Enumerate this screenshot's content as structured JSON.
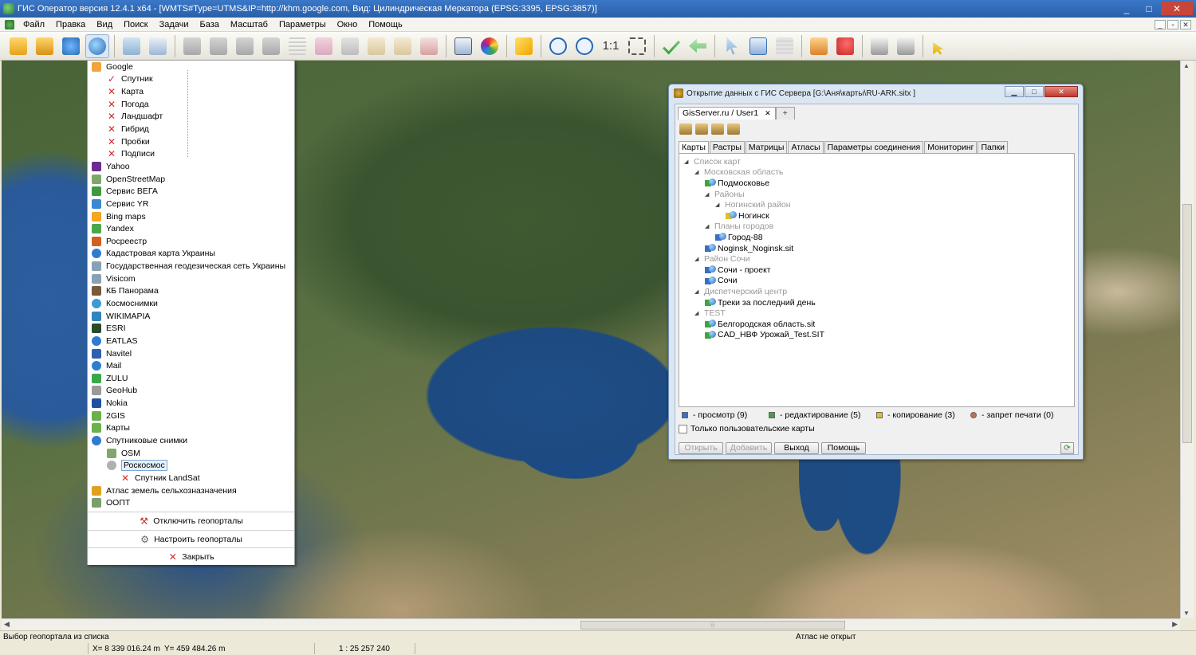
{
  "window": {
    "title": "ГИС Оператор версия 12.4.1 x64 - [WMTS#Type=UTMS&IP=http://khm.google.com, Вид: Цилиндрическая Меркатора (EPSG:3395, EPSG:3857)]",
    "controls": [
      "_",
      "□",
      "✕"
    ]
  },
  "menubar": {
    "items": [
      "Файл",
      "Правка",
      "Вид",
      "Поиск",
      "Задачи",
      "База",
      "Масштаб",
      "Параметры",
      "Окно",
      "Помощь"
    ],
    "mdi_controls": [
      "_",
      "▫",
      "✕"
    ]
  },
  "toolbar": {
    "scale_button": "1:1"
  },
  "geoportal_menu": {
    "items": [
      {
        "label": "Google",
        "icon": "google-icon",
        "level": 0,
        "color": "#f2a33a"
      },
      {
        "label": "Спутник",
        "icon": "check-icon",
        "level": 1
      },
      {
        "label": "Карта",
        "icon": "cross-icon",
        "level": 1
      },
      {
        "label": "Погода",
        "icon": "cross-icon",
        "level": 1
      },
      {
        "label": "Ландшафт",
        "icon": "cross-icon",
        "level": 1
      },
      {
        "label": "Гибрид",
        "icon": "cross-icon",
        "level": 1
      },
      {
        "label": "Пробки",
        "icon": "cross-icon",
        "level": 1
      },
      {
        "label": "Подписи",
        "icon": "cross-icon",
        "level": 1
      },
      {
        "label": "Yahoo",
        "icon": "yahoo-icon",
        "level": 0,
        "color": "#6b2c91"
      },
      {
        "label": "OpenStreetMap",
        "icon": "osm-icon",
        "level": 0,
        "color": "#7ea86b"
      },
      {
        "label": "Сервис ВЕГА",
        "icon": "vega-icon",
        "level": 0,
        "color": "#3e9a3e"
      },
      {
        "label": "Сервис YR",
        "icon": "yr-icon",
        "level": 0,
        "color": "#3a88d0"
      },
      {
        "label": "Bing maps",
        "icon": "bing-icon",
        "level": 0,
        "color": "#f5a623"
      },
      {
        "label": "Yandex",
        "icon": "yandex-icon",
        "level": 0,
        "color": "#4aa84a"
      },
      {
        "label": "Росреестр",
        "icon": "rosreestr-icon",
        "level": 0,
        "color": "#d06020"
      },
      {
        "label": "Кадастровая карта Украины",
        "icon": "globe-icon",
        "level": 0,
        "color": "#2f7bd0"
      },
      {
        "label": "Государственная геодезическая сеть Украины",
        "icon": "geodesic-icon",
        "level": 0,
        "color": "#8aa0b5"
      },
      {
        "label": "Visicom",
        "icon": "visicom-icon",
        "level": 0,
        "color": "#8aa0b5"
      },
      {
        "label": "КБ Панорама",
        "icon": "panorama-icon",
        "level": 0,
        "color": "#7a5a3a"
      },
      {
        "label": "Космоснимки",
        "icon": "kosmosnimki-icon",
        "level": 0,
        "color": "#3b9ad6"
      },
      {
        "label": "WIKIMAPIA",
        "icon": "wikimapia-icon",
        "level": 0,
        "color": "#2e86c1"
      },
      {
        "label": "ESRI",
        "icon": "esri-icon",
        "level": 0,
        "color": "#2a4a2a"
      },
      {
        "label": "EATLAS",
        "icon": "eatlas-icon",
        "level": 0,
        "color": "#2f7bd0"
      },
      {
        "label": "Navitel",
        "icon": "navitel-icon",
        "level": 0,
        "color": "#2f5fb0"
      },
      {
        "label": "Mail",
        "icon": "mail-icon",
        "level": 0,
        "color": "#2f7bd0"
      },
      {
        "label": "ZULU",
        "icon": "zulu-icon",
        "level": 0,
        "color": "#3aa84a"
      },
      {
        "label": "GeoHub",
        "icon": "geohub-icon",
        "level": 0,
        "color": "#9a9a9a"
      },
      {
        "label": "Nokia",
        "icon": "nokia-icon",
        "level": 0,
        "color": "#1f4f9f"
      },
      {
        "label": "2GIS",
        "icon": "2gis-icon",
        "level": 0,
        "color": "#6ab04c"
      },
      {
        "label": "Карты",
        "icon": "maps-icon",
        "level": 0,
        "color": "#6ab04c"
      },
      {
        "label": "Спутниковые снимки",
        "icon": "satellite-icon",
        "level": 0,
        "color": "#2f7bd0"
      },
      {
        "label": "OSM",
        "icon": "osm-sub-icon",
        "level": 1,
        "color": "#7ea86b"
      },
      {
        "label": "Роскосмос",
        "icon": "roskosmos-icon",
        "level": 1,
        "color": "#b0b0b0",
        "selected": true
      },
      {
        "label": "Спутник LandSat",
        "icon": "cross-icon",
        "level": 2
      },
      {
        "label": "Атлас земель сельхозназначения",
        "icon": "atlas-icon",
        "level": 0,
        "color": "#e0a020"
      },
      {
        "label": "ООПТ",
        "icon": "oopt-icon",
        "level": 0,
        "color": "#7aa06a"
      }
    ],
    "footer": {
      "disable": "Отключить геопорталы",
      "configure": "Настроить геопорталы",
      "close": "Закрыть"
    }
  },
  "dialog": {
    "title": "Открытие данных с ГИС Сервера [G:\\Аня\\карты\\RU-ARK.sitx ]",
    "server_tab": "GisServer.ru / User1",
    "tabs": [
      "Карты",
      "Растры",
      "Матрицы",
      "Атласы",
      "Параметры соединения",
      "Мониторинг",
      "Папки"
    ],
    "active_tab": "Карты",
    "tree": [
      {
        "label": "Список карт",
        "level": 0,
        "type": "folder"
      },
      {
        "label": "Московская область",
        "level": 1,
        "type": "folder"
      },
      {
        "label": "Подмосковье",
        "level": 2,
        "type": "map",
        "access": "edit"
      },
      {
        "label": "Районы",
        "level": 2,
        "type": "folder"
      },
      {
        "label": "Ногинский район",
        "level": 3,
        "type": "folder"
      },
      {
        "label": "Ногинск",
        "level": 4,
        "type": "map",
        "access": "copy"
      },
      {
        "label": "Планы городов",
        "level": 2,
        "type": "folder"
      },
      {
        "label": "Город-88",
        "level": 3,
        "type": "map",
        "access": "view"
      },
      {
        "label": "Noginsk_Noginsk.sit",
        "level": 2,
        "type": "map",
        "access": "view"
      },
      {
        "label": "Район Сочи",
        "level": 1,
        "type": "folder"
      },
      {
        "label": "Сочи - проект",
        "level": 2,
        "type": "map",
        "access": "view"
      },
      {
        "label": "Сочи",
        "level": 2,
        "type": "map",
        "access": "view"
      },
      {
        "label": "Диспетчерский центр",
        "level": 1,
        "type": "folder"
      },
      {
        "label": "Треки за последний день",
        "level": 2,
        "type": "map",
        "access": "edit"
      },
      {
        "label": "TEST",
        "level": 1,
        "type": "folder"
      },
      {
        "label": "Белгородская область.sit",
        "level": 2,
        "type": "map",
        "access": "edit"
      },
      {
        "label": "CAD_НВФ Урожай_Test.SIT",
        "level": 2,
        "type": "map",
        "access": "edit"
      }
    ],
    "legend": [
      {
        "label": "- просмотр (9)",
        "color": "#3a6fc4"
      },
      {
        "label": "- редактирование (5)",
        "color": "#3aa83a"
      },
      {
        "label": "- копирование (3)",
        "color": "#e0c020"
      },
      {
        "label": "- запрет печати (0)",
        "color": "#c07050"
      }
    ],
    "only_user_maps": "Только пользовательские карты",
    "buttons": {
      "open": "Открыть",
      "add": "Добавить",
      "exit": "Выход",
      "help": "Помощь"
    },
    "access_colors": {
      "view": "#3a6fc4",
      "edit": "#3aa83a",
      "copy": "#e0c020"
    }
  },
  "statusbar": {
    "hint": "Выбор геопортала из списка",
    "atlas": "Атлас не открыт",
    "x": "X= 8 339 016.24 m",
    "y": "Y=   459 484.26 m",
    "scale": "1 : 25 257 240"
  }
}
